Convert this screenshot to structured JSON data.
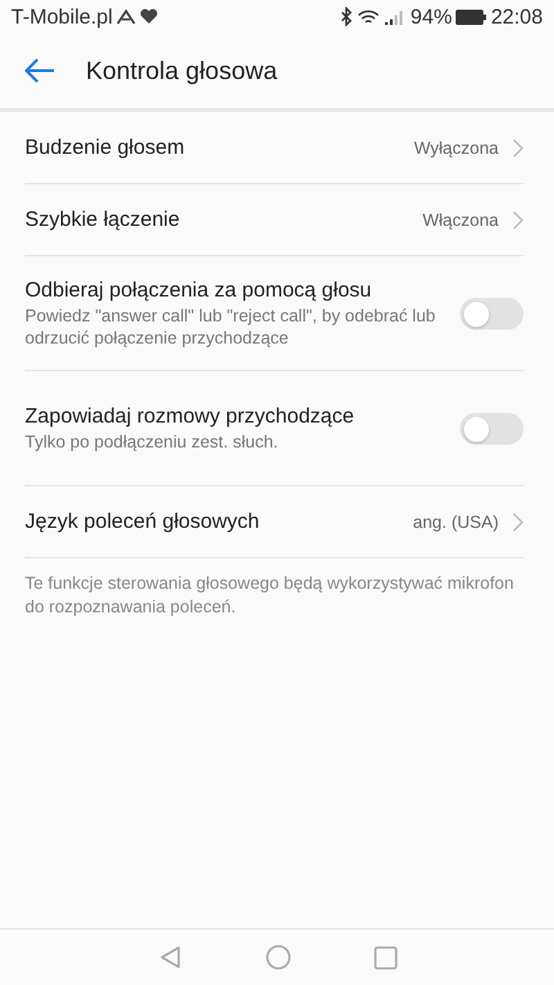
{
  "status_bar": {
    "carrier": "T-Mobile.pl",
    "battery": "94%",
    "time": "22:08"
  },
  "header": {
    "title": "Kontrola głosowa"
  },
  "items": [
    {
      "kind": "link",
      "label": "Budzenie głosem",
      "value": "Wyłączona"
    },
    {
      "kind": "link",
      "label": "Szybkie łączenie",
      "value": "Włączona"
    },
    {
      "kind": "switch",
      "label": "Odbieraj połączenia za pomocą głosu",
      "description": "Powiedz \"answer call\" lub \"reject call\", by odebrać lub odrzucić połączenie przychodzące",
      "on": false
    },
    {
      "kind": "switch",
      "label": "Zapowiadaj rozmowy przychodzące",
      "description": "Tylko po podłączeniu zest. słuch.",
      "on": false
    },
    {
      "kind": "link",
      "label": "Język poleceń głosowych",
      "value": "ang. (USA)"
    }
  ],
  "footer_note": "Te funkcje sterowania głosowego będą wykorzystywać mikrofon do rozpoznawania poleceń."
}
